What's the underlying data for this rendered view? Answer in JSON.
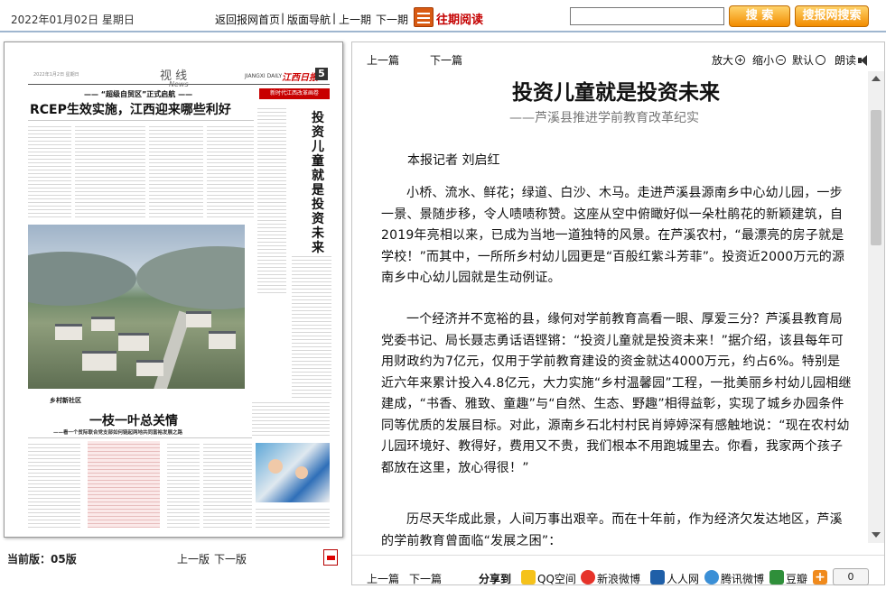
{
  "topbar": {
    "date": "2022年01月02日 星期日",
    "home_link": "返回报网首页",
    "sep": "|",
    "nav_link": "版面导航",
    "prev_issue": "上一期",
    "next_issue": "下一期",
    "past_reading": "往期阅读",
    "search_input_value": "",
    "search_button": "搜 索",
    "site_search_button": "搜报网搜索"
  },
  "newspaper": {
    "section_name": "视 线",
    "section_en": "News",
    "masthead_en": "JIANGXI DAILY",
    "masthead_cn": "江西日报",
    "page_number": "5",
    "column_tag": "新时代江西改革画卷",
    "headline1_kicker": "—— “超级自贸区”正式启航 ——",
    "headline1": "RCEP生效实施，江西迎来哪些利好",
    "vertical_headline": "投资儿童就是投资未来",
    "photo_caption": "乡村新社区",
    "headline2": "一枝一叶总关情",
    "headline2_sub": "——看一个贫际联合党支部如何链起两地共同富裕发展之路"
  },
  "left_footer": {
    "current_page_label": "当前版：",
    "current_page_value": "05版",
    "prev_page": "上一版",
    "next_page": "下一版"
  },
  "article_toolbar": {
    "prev": "上一篇",
    "next": "下一篇",
    "zoom_in": "放大",
    "zoom_out": "缩小",
    "default": "默认",
    "read_aloud": "朗读"
  },
  "article": {
    "title": "投资儿童就是投资未来",
    "subtitle": "——芦溪县推进学前教育改革纪实",
    "byline": "本报记者 刘启红",
    "paragraphs": [
      "小桥、流水、鲜花；绿道、白沙、木马。走进芦溪县源南乡中心幼儿园，一步一景、景随步移，令人啧啧称赞。这座从空中俯瞰好似一朵杜鹃花的新颖建筑，自2019年亮相以来，已成为当地一道独特的风景。在芦溪农村，“最漂亮的房子就是学校！”而其中，一所所乡村幼儿园更是“百般红紫斗芳菲”。投资近2000万元的源南乡中心幼儿园就是生动例证。",
      "一个经济并不宽裕的县，缘何对学前教育高看一眼、厚爱三分？芦溪县教育局党委书记、局长聂志勇话语铿锵：“投资儿童就是投资未来！”据介绍，该县每年可用财政约为7亿元，仅用于学前教育建设的资金就达4000万元，约占6%。特别是近六年来累计投入4.8亿元，大力实施“乡村温馨园”工程，一批美丽乡村幼儿园相继建成，“书香、雅致、童趣”与“自然、生态、野趣”相得益彰，实现了城乡办园条件同等优质的发展目标。对此，源南乡石北村村民肖婷婷深有感触地说：“现在农村幼儿园环境好、教得好，费用又不贵，我们根本不用跑城里去。你看，我家两个孩子都放在这里，放心得很！”",
      "历尽天华成此景，人间万事出艰辛。而在十年前，作为经济欠发达地区，芦溪的学前教育曾面临“发展之困”："
    ]
  },
  "article_footer": {
    "prev": "上一篇",
    "next": "下一篇",
    "share_label": "分享到",
    "share_targets": [
      "QQ空间",
      "新浪微博",
      "人人网",
      "腾讯微博",
      "豆瓣"
    ],
    "share_count": "0"
  }
}
